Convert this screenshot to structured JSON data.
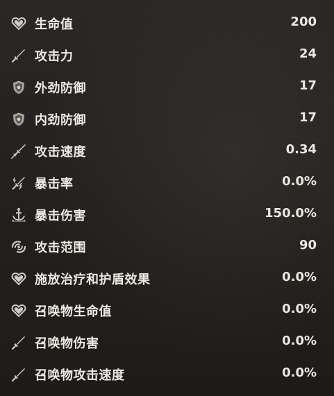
{
  "stats": [
    {
      "icon": "heart-icon",
      "label": "生命值",
      "value": "200"
    },
    {
      "icon": "sword-icon",
      "label": "攻击力",
      "value": "24"
    },
    {
      "icon": "shield-icon",
      "label": "外劲防御",
      "value": "17"
    },
    {
      "icon": "shield-icon",
      "label": "内劲防御",
      "value": "17"
    },
    {
      "icon": "double-sword-icon",
      "label": "攻击速度",
      "value": "0.34"
    },
    {
      "icon": "lightning-sword-icon",
      "label": "暴击率",
      "value": "0.0%"
    },
    {
      "icon": "anchor-burst-icon",
      "label": "暴击伤害",
      "value": "150.0%"
    },
    {
      "icon": "vortex-icon",
      "label": "攻击范围",
      "value": "90"
    },
    {
      "icon": "heart-icon",
      "label": "施放治疗和护盾效果",
      "value": "0.0%"
    },
    {
      "icon": "heart-icon",
      "label": "召唤物生命值",
      "value": "0.0%"
    },
    {
      "icon": "sword-icon",
      "label": "召唤物伤害",
      "value": "0.0%"
    },
    {
      "icon": "sword-icon",
      "label": "召唤物攻击速度",
      "value": "0.0%"
    }
  ],
  "colors": {
    "text": "#ece8e2",
    "icon": "#cfcac3",
    "background": "#23211f"
  }
}
